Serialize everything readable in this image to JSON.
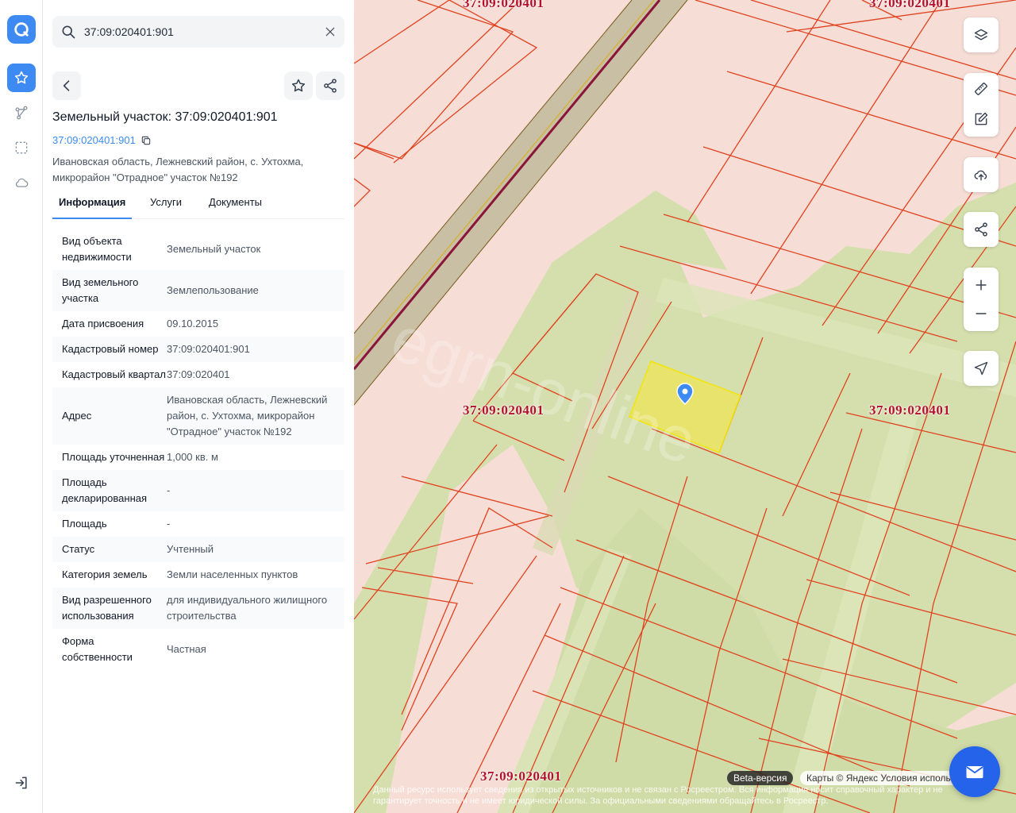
{
  "search": {
    "value": "37:09:020401:901"
  },
  "object": {
    "title": "Земельный участок: 37:09:020401:901",
    "cad_number": "37:09:020401:901",
    "address_line1": "Ивановская область, Лежневский район, с. Ухтохма,",
    "address_line2": "микрорайон \"Отрадное\" участок №192"
  },
  "tabs": [
    {
      "label": "Информация",
      "active": true
    },
    {
      "label": "Услуги",
      "active": false
    },
    {
      "label": "Документы",
      "active": false
    }
  ],
  "info_rows": [
    {
      "key": "Вид объекта недвижимости",
      "value": "Земельный участок"
    },
    {
      "key": "Вид земельного участка",
      "value": "Землепользование"
    },
    {
      "key": "Дата присвоения",
      "value": "09.10.2015"
    },
    {
      "key": "Кадастровый номер",
      "value": "37:09:020401:901"
    },
    {
      "key": "Кадастровый квартал",
      "value": "37:09:020401"
    },
    {
      "key": "Адрес",
      "value": "Ивановская область, Лежневский район, с. Ухтохма, микрорайон \"Отрадное\" участок №192"
    },
    {
      "key": "Площадь уточненная",
      "value": "1,000 кв. м"
    },
    {
      "key": "Площадь декларированная",
      "value": "-"
    },
    {
      "key": "Площадь",
      "value": "-"
    },
    {
      "key": "Статус",
      "value": "Учтенный"
    },
    {
      "key": "Категория земель",
      "value": "Земли населенных пунктов"
    },
    {
      "key": "Вид разрешенного использования",
      "value": "для индивидуального жилищного строительства"
    },
    {
      "key": "Форма собственности",
      "value": "Частная"
    }
  ],
  "map": {
    "quarter_label": "37:09:020401",
    "beta_label": "Beta-версия",
    "attribution": "Карты © Яндекс   Условия использования",
    "disclaimer": "Данный ресурс использует сведения из открытых источников и не связан с Росреестром. Вся информация носит справочный характер и не гарантирует точность и не имеет юридической силы. За официальными сведениями обращайтесь в Росреестр."
  },
  "colors": {
    "accent": "#3d8bf2",
    "plot_fill": "#f4c6bd",
    "plot_stroke": "#e0431f",
    "greenery": "#d5dfae",
    "selected_fill": "#e8e46a",
    "label": "#b3122a"
  }
}
